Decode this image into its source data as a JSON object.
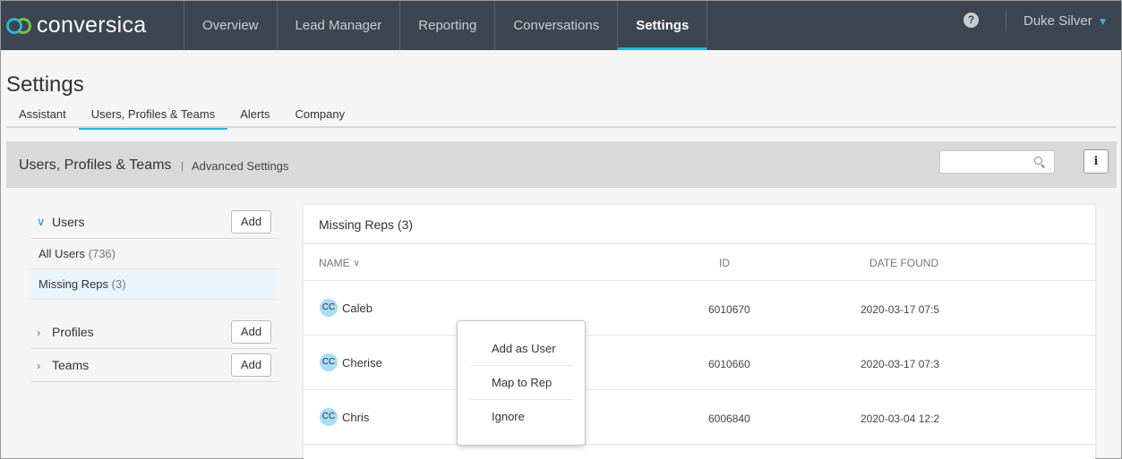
{
  "brand": {
    "name": "conversica",
    "colors": {
      "primary": "#2bb3d6",
      "secondary": "#7bc043",
      "nav_bg": "#3d4550"
    }
  },
  "nav": {
    "items": [
      {
        "label": "Overview"
      },
      {
        "label": "Lead Manager"
      },
      {
        "label": "Reporting"
      },
      {
        "label": "Conversations"
      },
      {
        "label": "Settings",
        "active": true
      }
    ],
    "help_icon": "question-circle-icon",
    "help_glyph": "?",
    "user_name": "Duke Silver",
    "user_chevron": "chevron-down-icon"
  },
  "page": {
    "title": "Settings"
  },
  "tabs": [
    {
      "label": "Assistant"
    },
    {
      "label": "Users, Profiles & Teams",
      "active": true
    },
    {
      "label": "Alerts"
    },
    {
      "label": "Company"
    }
  ],
  "section": {
    "title": "Users, Profiles & Teams",
    "separator": "|",
    "subtitle": "Advanced Settings",
    "search_placeholder": "",
    "info_glyph": "i"
  },
  "sidebar": {
    "add_label": "Add",
    "groups": [
      {
        "label": "Users",
        "expanded": true,
        "items": [
          {
            "label": "All Users",
            "count": "(736)"
          },
          {
            "label": "Missing Reps",
            "count": "(3)",
            "selected": true
          }
        ]
      },
      {
        "label": "Profiles",
        "expanded": false
      },
      {
        "label": "Teams",
        "expanded": false
      }
    ]
  },
  "card": {
    "title": "Missing Reps (3)",
    "columns": {
      "name": "NAME",
      "id": "ID",
      "date": "DATE FOUND"
    },
    "rows": [
      {
        "initials": "CC",
        "name": "Caleb",
        "id": "6010670",
        "date": "2020-03-17 07:5"
      },
      {
        "initials": "CC",
        "name": "Cherise",
        "id": "6010660",
        "date": "2020-03-17 07:3"
      },
      {
        "initials": "CC",
        "name": "Chris",
        "id": "6006840",
        "date": "2020-03-04 12:2"
      }
    ]
  },
  "context_menu": {
    "items": [
      {
        "label": "Add as User"
      },
      {
        "label": "Map to Rep"
      },
      {
        "label": "Ignore"
      }
    ]
  }
}
